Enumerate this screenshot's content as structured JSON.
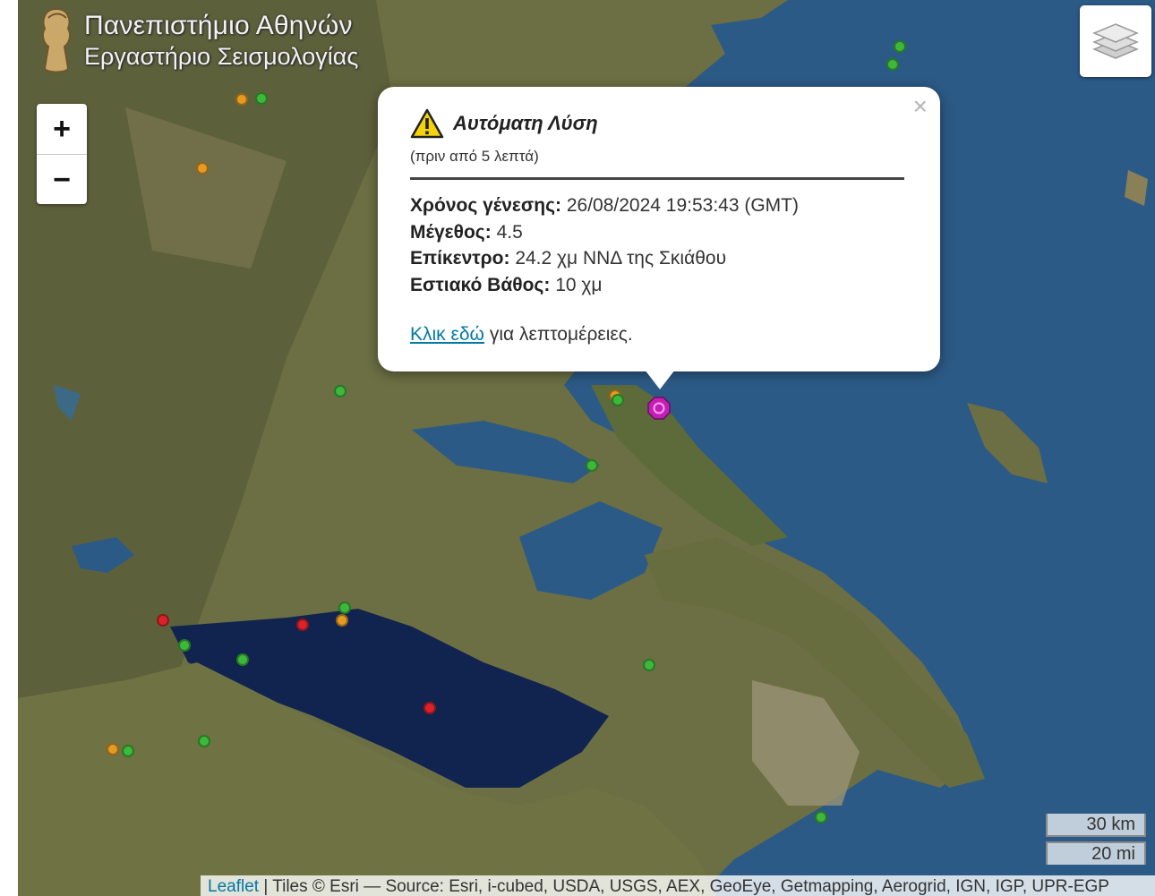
{
  "logo": {
    "line1": "Πανεπιστήμιο Αθηνών",
    "line2": "Εργαστήριο Σεισμολογίας"
  },
  "zoom": {
    "in_label": "+",
    "out_label": "−"
  },
  "layers": {
    "icon": "layers-icon"
  },
  "popup": {
    "title": "Αυτόματη Λύση",
    "ago": "(πριν από 5 λεπτά)",
    "origin_time_label": "Χρόνος γένεσης:",
    "origin_time_value": "26/08/2024 19:53:43 (GMT)",
    "magnitude_label": "Μέγεθος:",
    "magnitude_value": "4.5",
    "epicenter_label": "Επίκεντρο:",
    "epicenter_value": "24.2 χμ ΝΝΔ της Σκιάθου",
    "depth_label": "Εστιακό Βάθος:",
    "depth_value": "10 χμ",
    "link_text": "Κλικ εδώ",
    "link_suffix": "για λεπτομέρειες.",
    "close": "×"
  },
  "scale": {
    "km": "30 km",
    "mi": "20 mi"
  },
  "attribution": {
    "leaflet": "Leaflet",
    "text": "| Tiles © Esri — Source: Esri, i-cubed, USDA, USGS, AEX, GeoEye, Getmapping, Aerogrid, IGN, IGP, UPR-EGP"
  },
  "colors": {
    "green": "#3db83a",
    "orange": "#e59a22",
    "red": "#d9222a",
    "epicenter": "#c21fb4",
    "link": "#0078a8"
  }
}
